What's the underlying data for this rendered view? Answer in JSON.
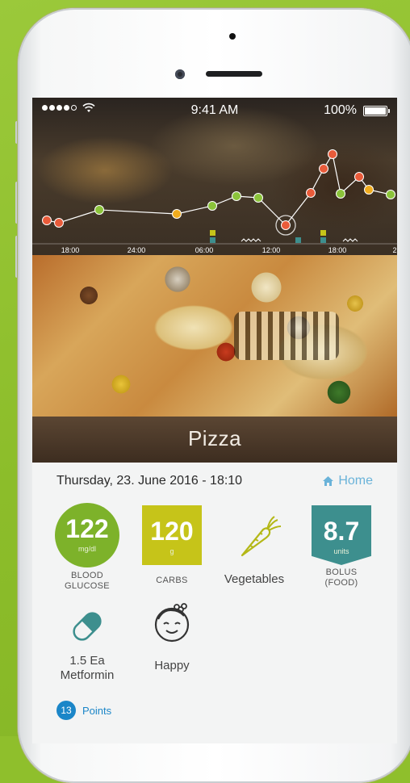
{
  "status_bar": {
    "time": "9:41 AM",
    "battery": "100%"
  },
  "chart_data": {
    "type": "line",
    "x_ticks": [
      "18:00",
      "24:00",
      "06:00",
      "12:00",
      "18:00",
      "2"
    ],
    "colors": {
      "low": "#e95b3a",
      "in_range": "#8bc33a",
      "elevated": "#f0ac1e",
      "line": "#ffffff"
    },
    "markers": {
      "carbs": "#c6c419",
      "insulin": "#3d8f8e"
    }
  },
  "meal": {
    "title": "Pizza",
    "datetime": "Thursday, 23. June 2016 - 18:10",
    "location": "Home"
  },
  "tiles": {
    "glucose": {
      "value": "122",
      "unit": "mg/dl",
      "caption": "BLOOD\nGLUCOSE",
      "color": "#7db22a"
    },
    "carbs": {
      "value": "120",
      "unit": "g",
      "caption": "CARBS",
      "color": "#c6c419"
    },
    "food": {
      "caption": "Vegetables",
      "icon": "carrot-icon"
    },
    "bolus": {
      "value": "8.7",
      "unit": "units",
      "caption": "BOLUS\n(FOOD)",
      "color": "#3d8f8e"
    },
    "medication": {
      "caption": "1.5 Ea\nMetformin",
      "icon": "pill-icon"
    },
    "mood": {
      "caption": "Happy",
      "icon": "happy-face-icon"
    }
  },
  "points": {
    "count": "13",
    "label": "Points"
  }
}
